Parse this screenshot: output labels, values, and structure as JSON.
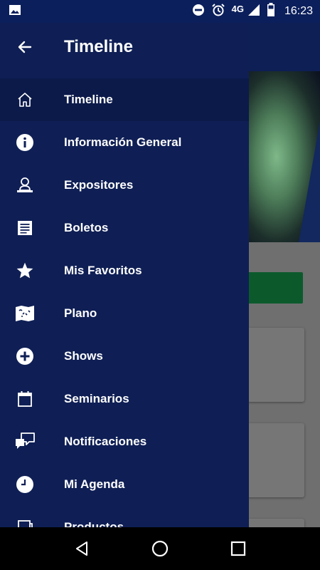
{
  "status_bar": {
    "time": "16:23",
    "network": "4G",
    "icons": [
      "image-icon",
      "do-not-disturb-icon",
      "alarm-icon",
      "signal-icon",
      "battery-icon"
    ]
  },
  "drawer": {
    "title": "Timeline",
    "items": [
      {
        "label": "Timeline",
        "icon": "home-icon",
        "active": true
      },
      {
        "label": "Información General",
        "icon": "info-icon"
      },
      {
        "label": "Expositores",
        "icon": "exhibitor-icon"
      },
      {
        "label": "Boletos",
        "icon": "ticket-icon"
      },
      {
        "label": "Mis Favoritos",
        "icon": "star-icon"
      },
      {
        "label": "Plano",
        "icon": "map-icon"
      },
      {
        "label": "Shows",
        "icon": "add-circle-icon"
      },
      {
        "label": "Seminarios",
        "icon": "calendar-icon"
      },
      {
        "label": "Notificaciones",
        "icon": "chat-icon"
      },
      {
        "label": "Mi Agenda",
        "icon": "clock-icon"
      },
      {
        "label": "Productos",
        "icon": "product-icon"
      }
    ]
  },
  "nav_bar": {
    "buttons": [
      "back-nav-icon",
      "home-nav-icon",
      "recents-nav-icon"
    ]
  },
  "colors": {
    "drawer_bg": "#0f1f55",
    "status_bar_bg": "#0b1f5c",
    "active_item_bg": "#0c1a4a",
    "text": "#ffffff"
  }
}
